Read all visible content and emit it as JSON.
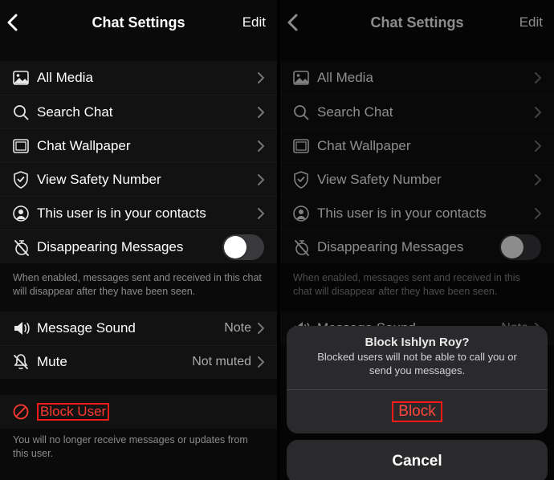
{
  "header": {
    "title": "Chat Settings",
    "edit": "Edit"
  },
  "rows": {
    "all_media": "All Media",
    "search_chat": "Search Chat",
    "chat_wallpaper": "Chat Wallpaper",
    "view_safety": "View Safety Number",
    "in_contacts": "This user is in your contacts",
    "disappearing": "Disappearing Messages",
    "msg_sound": "Message Sound",
    "msg_sound_value": "Note",
    "mute": "Mute",
    "mute_value": "Not muted",
    "block_user": "Block User"
  },
  "hints": {
    "disappearing": "When enabled, messages sent and received in this chat will disappear after they have been seen.",
    "block": "You will no longer receive messages or updates from this user."
  },
  "sheet": {
    "title": "Block Ishlyn Roy?",
    "sub": "Blocked users will not be able to call you or send you messages.",
    "block": "Block",
    "cancel": "Cancel"
  }
}
